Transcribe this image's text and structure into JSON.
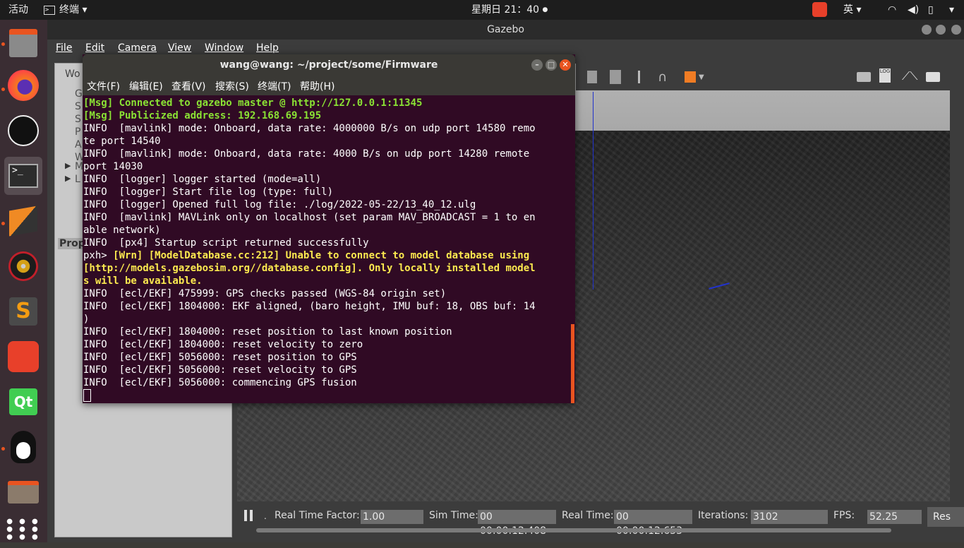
{
  "topbar": {
    "activities": "活动",
    "app_menu": "终端",
    "clock": "星期日 21：40",
    "input_method": "英"
  },
  "gazebo": {
    "title": "Gazebo",
    "menu": [
      "File",
      "Edit",
      "Camera",
      "View",
      "Window",
      "Help"
    ],
    "panel_tab_partial": "Wo",
    "panel_rows_partial": [
      "G",
      "S",
      "S",
      "P",
      "A",
      "W",
      "M",
      "L"
    ],
    "props_label": "Prop",
    "status": {
      "rtf_label": "Real Time Factor:",
      "rtf_value": "1.00",
      "sim_label": "Sim Time:",
      "sim_value": "00 00:00:12.408",
      "real_label": "Real Time:",
      "real_value": "00 00:00:12.653",
      "iter_label": "Iterations:",
      "iter_value": "3102",
      "fps_label": "FPS:",
      "fps_value": "52.25",
      "reset_partial": "Res"
    }
  },
  "terminal": {
    "title": "wang@wang: ~/project/some/Firmware",
    "menu": [
      "文件(F)",
      "编辑(E)",
      "查看(V)",
      "搜索(S)",
      "终端(T)",
      "帮助(H)"
    ],
    "lines": [
      {
        "cls": "ok",
        "text": "[Msg] Connected to gazebo master @ http://127.0.0.1:11345"
      },
      {
        "cls": "ok",
        "text": "[Msg] Publicized address: 192.168.69.195"
      },
      {
        "cls": "",
        "text": "INFO  [mavlink] mode: Onboard, data rate: 4000000 B/s on udp port 14580 remo"
      },
      {
        "cls": "",
        "text": "te port 14540"
      },
      {
        "cls": "",
        "text": "INFO  [mavlink] mode: Onboard, data rate: 4000 B/s on udp port 14280 remote"
      },
      {
        "cls": "",
        "text": "port 14030"
      },
      {
        "cls": "",
        "text": "INFO  [logger] logger started (mode=all)"
      },
      {
        "cls": "",
        "text": "INFO  [logger] Start file log (type: full)"
      },
      {
        "cls": "",
        "text": "INFO  [logger] Opened full log file: ./log/2022-05-22/13_40_12.ulg"
      },
      {
        "cls": "",
        "text": "INFO  [mavlink] MAVLink only on localhost (set param MAV_BROADCAST = 1 to en"
      },
      {
        "cls": "",
        "text": "able network)"
      },
      {
        "cls": "",
        "text": "INFO  [px4] Startup script returned successfully"
      },
      {
        "cls": "mixed",
        "text": "pxh> ",
        "warn": "[Wrn] [ModelDatabase.cc:212] Unable to connect to model database using"
      },
      {
        "cls": "warn",
        "text": "[http://models.gazebosim.org//database.config]. Only locally installed model"
      },
      {
        "cls": "warn",
        "text": "s will be available."
      },
      {
        "cls": "",
        "text": "INFO  [ecl/EKF] 475999: GPS checks passed (WGS-84 origin set)"
      },
      {
        "cls": "",
        "text": "INFO  [ecl/EKF] 1804000: EKF aligned, (baro height, IMU buf: 18, OBS buf: 14"
      },
      {
        "cls": "",
        "text": ")"
      },
      {
        "cls": "",
        "text": "INFO  [ecl/EKF] 1804000: reset position to last known position"
      },
      {
        "cls": "",
        "text": "INFO  [ecl/EKF] 1804000: reset velocity to zero"
      },
      {
        "cls": "",
        "text": "INFO  [ecl/EKF] 5056000: reset position to GPS"
      },
      {
        "cls": "",
        "text": "INFO  [ecl/EKF] 5056000: reset velocity to GPS"
      },
      {
        "cls": "",
        "text": "INFO  [ecl/EKF] 5056000: commencing GPS fusion"
      }
    ]
  },
  "dock": [
    "files-icon",
    "firefox-icon",
    "obs-icon",
    "terminal-icon",
    "virtualbox-icon",
    "disk-icon",
    "sublime-icon",
    "xmind-icon",
    "qt-icon",
    "qq-icon",
    "folder-icon",
    "apps-grid-icon"
  ]
}
